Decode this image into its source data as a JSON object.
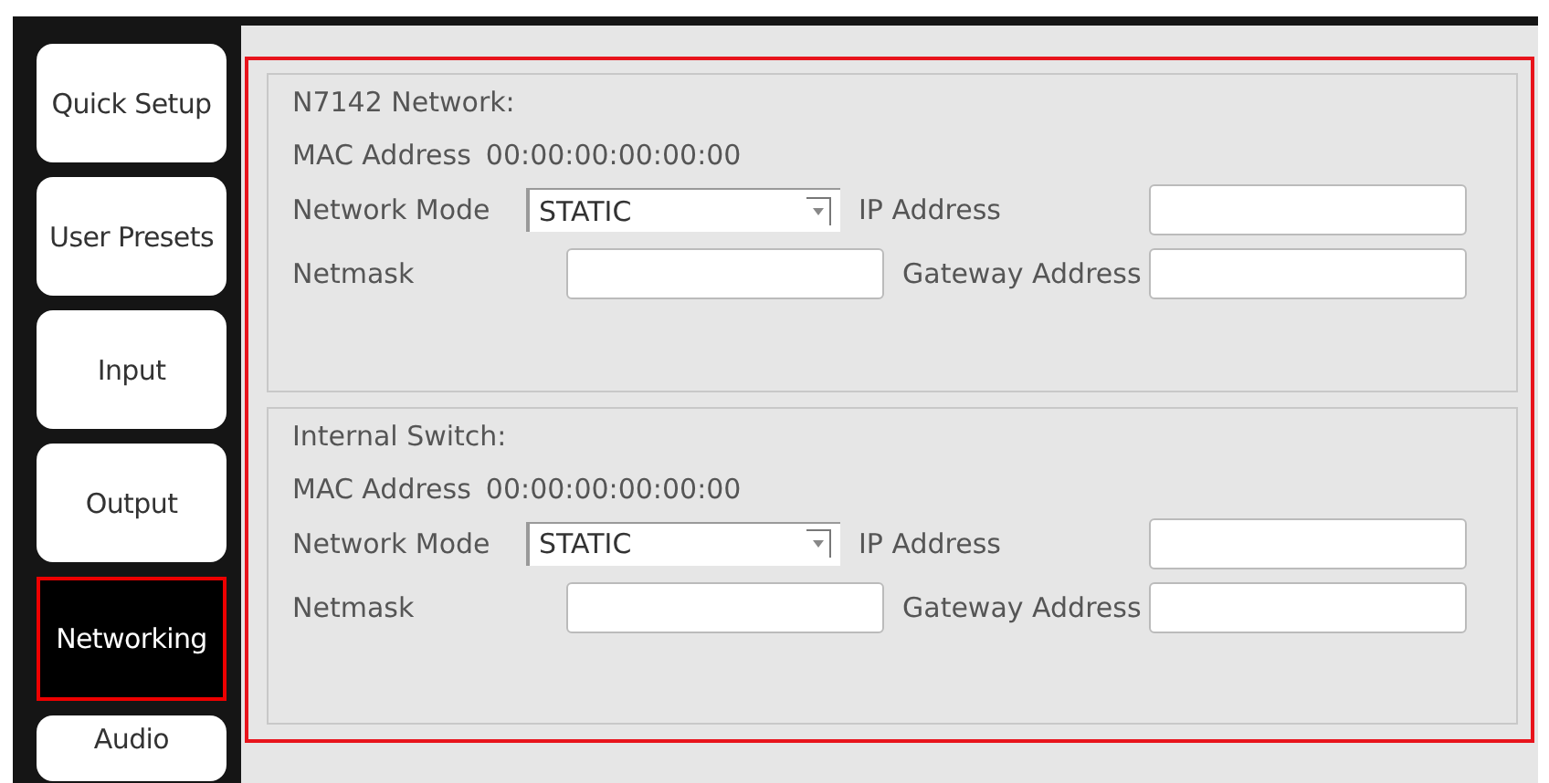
{
  "sidebar": {
    "items": [
      {
        "label": "Quick Setup",
        "selected": false
      },
      {
        "label": "User Presets",
        "selected": false
      },
      {
        "label": "Input",
        "selected": false
      },
      {
        "label": "Output",
        "selected": false
      },
      {
        "label": "Networking",
        "selected": true
      },
      {
        "label": "Audio",
        "selected": false
      }
    ]
  },
  "sections": [
    {
      "title": "N7142 Network:",
      "mac_label": "MAC Address",
      "mac_value": "00:00:00:00:00:00",
      "mode_label": "Network Mode",
      "mode_value": "STATIC",
      "ip_label": "IP Address",
      "netmask_label": "Netmask",
      "gateway_label": "Gateway Address"
    },
    {
      "title": "Internal Switch:",
      "mac_label": "MAC Address",
      "mac_value": "00:00:00:00:00:00",
      "mode_label": "Network Mode",
      "mode_value": "STATIC",
      "ip_label": "IP Address",
      "netmask_label": "Netmask",
      "gateway_label": "Gateway Address"
    }
  ]
}
